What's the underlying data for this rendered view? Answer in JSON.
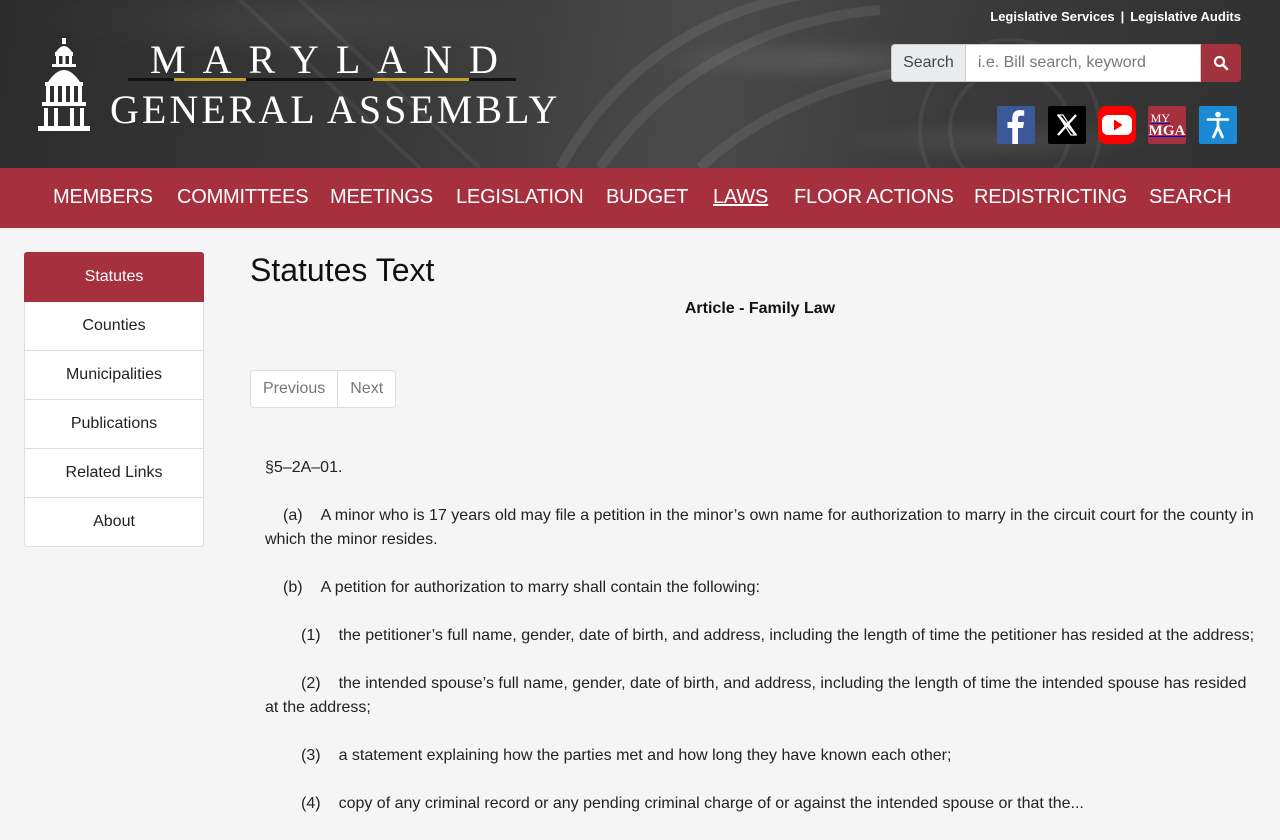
{
  "header": {
    "logo_line1": "MARYLAND",
    "logo_line2": "GENERAL ASSEMBLY",
    "top_links": [
      "Legislative Services",
      "Legislative Audits"
    ],
    "top_links_separator": "|",
    "search_label": "Search",
    "search_placeholder": "i.e. Bill search, keyword",
    "social": [
      {
        "name": "facebook-icon",
        "color": "#3b5998"
      },
      {
        "name": "x-icon",
        "color": "#000000"
      },
      {
        "name": "youtube-icon",
        "color": "#ff0000"
      },
      {
        "name": "mymga-icon",
        "color": "#a6303e",
        "text_top": "MY",
        "text_bottom": "MGA"
      },
      {
        "name": "accessibility-icon",
        "color": "#1a8ad4"
      }
    ],
    "accent_gold": "#c9a02a"
  },
  "nav": {
    "items": [
      "MEMBERS",
      "COMMITTEES",
      "MEETINGS",
      "LEGISLATION",
      "BUDGET",
      "LAWS",
      "FLOOR ACTIONS",
      "REDISTRICTING",
      "SEARCH"
    ],
    "active": "LAWS",
    "color": "#a6303e"
  },
  "sidebar": {
    "items": [
      "Statutes",
      "Counties",
      "Municipalities",
      "Publications",
      "Related Links",
      "About"
    ],
    "active": "Statutes"
  },
  "main": {
    "title": "Statutes Text",
    "article": "Article - Family Law",
    "pager": {
      "previous": "Previous",
      "next": "Next"
    },
    "section": "§5–2A–01.",
    "paragraphs": [
      {
        "label": "(a)",
        "text": "A minor who is 17 years old may file a petition in the minor’s own name for authorization to marry in the circuit court for the county in which the minor resides."
      },
      {
        "label": "(b)",
        "text": "A petition for authorization to marry shall contain the following:"
      },
      {
        "label": "(1)",
        "text": "the petitioner’s full name, gender, date of birth, and address, including the length of time the petitioner has resided at the address;"
      },
      {
        "label": "(2)",
        "text": "the intended spouse’s full name, gender, date of birth, and address, including the length of time the intended spouse has resided at the address;"
      },
      {
        "label": "(3)",
        "text": "a statement explaining how the parties met and how long they have known each other;"
      },
      {
        "label": "(4)",
        "text": "copy of any criminal record or any pending criminal charge of or against the intended spouse or that the..."
      }
    ]
  }
}
